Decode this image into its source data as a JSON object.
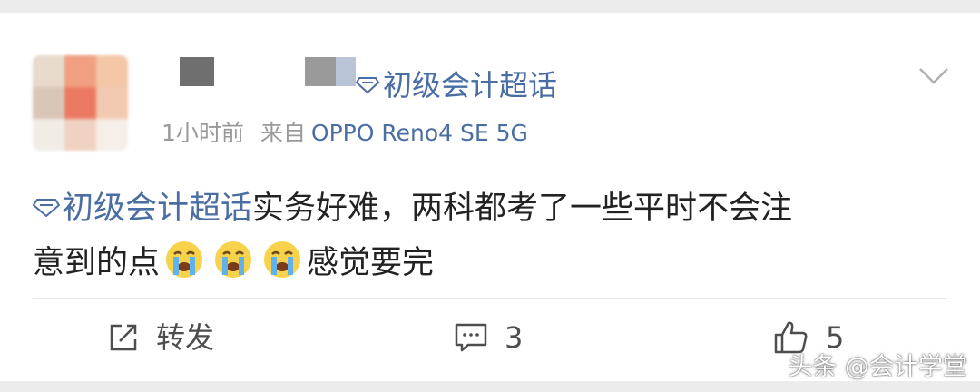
{
  "post": {
    "topic_tag": "初级会计超话",
    "time": "1小时前",
    "source_prefix": "来自",
    "device": "OPPO Reno4 SE 5G",
    "body_topic": "初级会计超话",
    "body_text_1": "实务好难，两科都考了一些平时不会注",
    "body_text_2": "意到的点",
    "body_text_3": "感觉要完",
    "emoji_name": "crying-face-icon"
  },
  "actions": {
    "repost_label": "转发",
    "comment_count": "3",
    "like_count": "5"
  },
  "watermark": "头条 @会计学堂",
  "colors": {
    "link_blue": "#4a6ea3",
    "text": "#222222",
    "meta_gray": "#999999"
  }
}
